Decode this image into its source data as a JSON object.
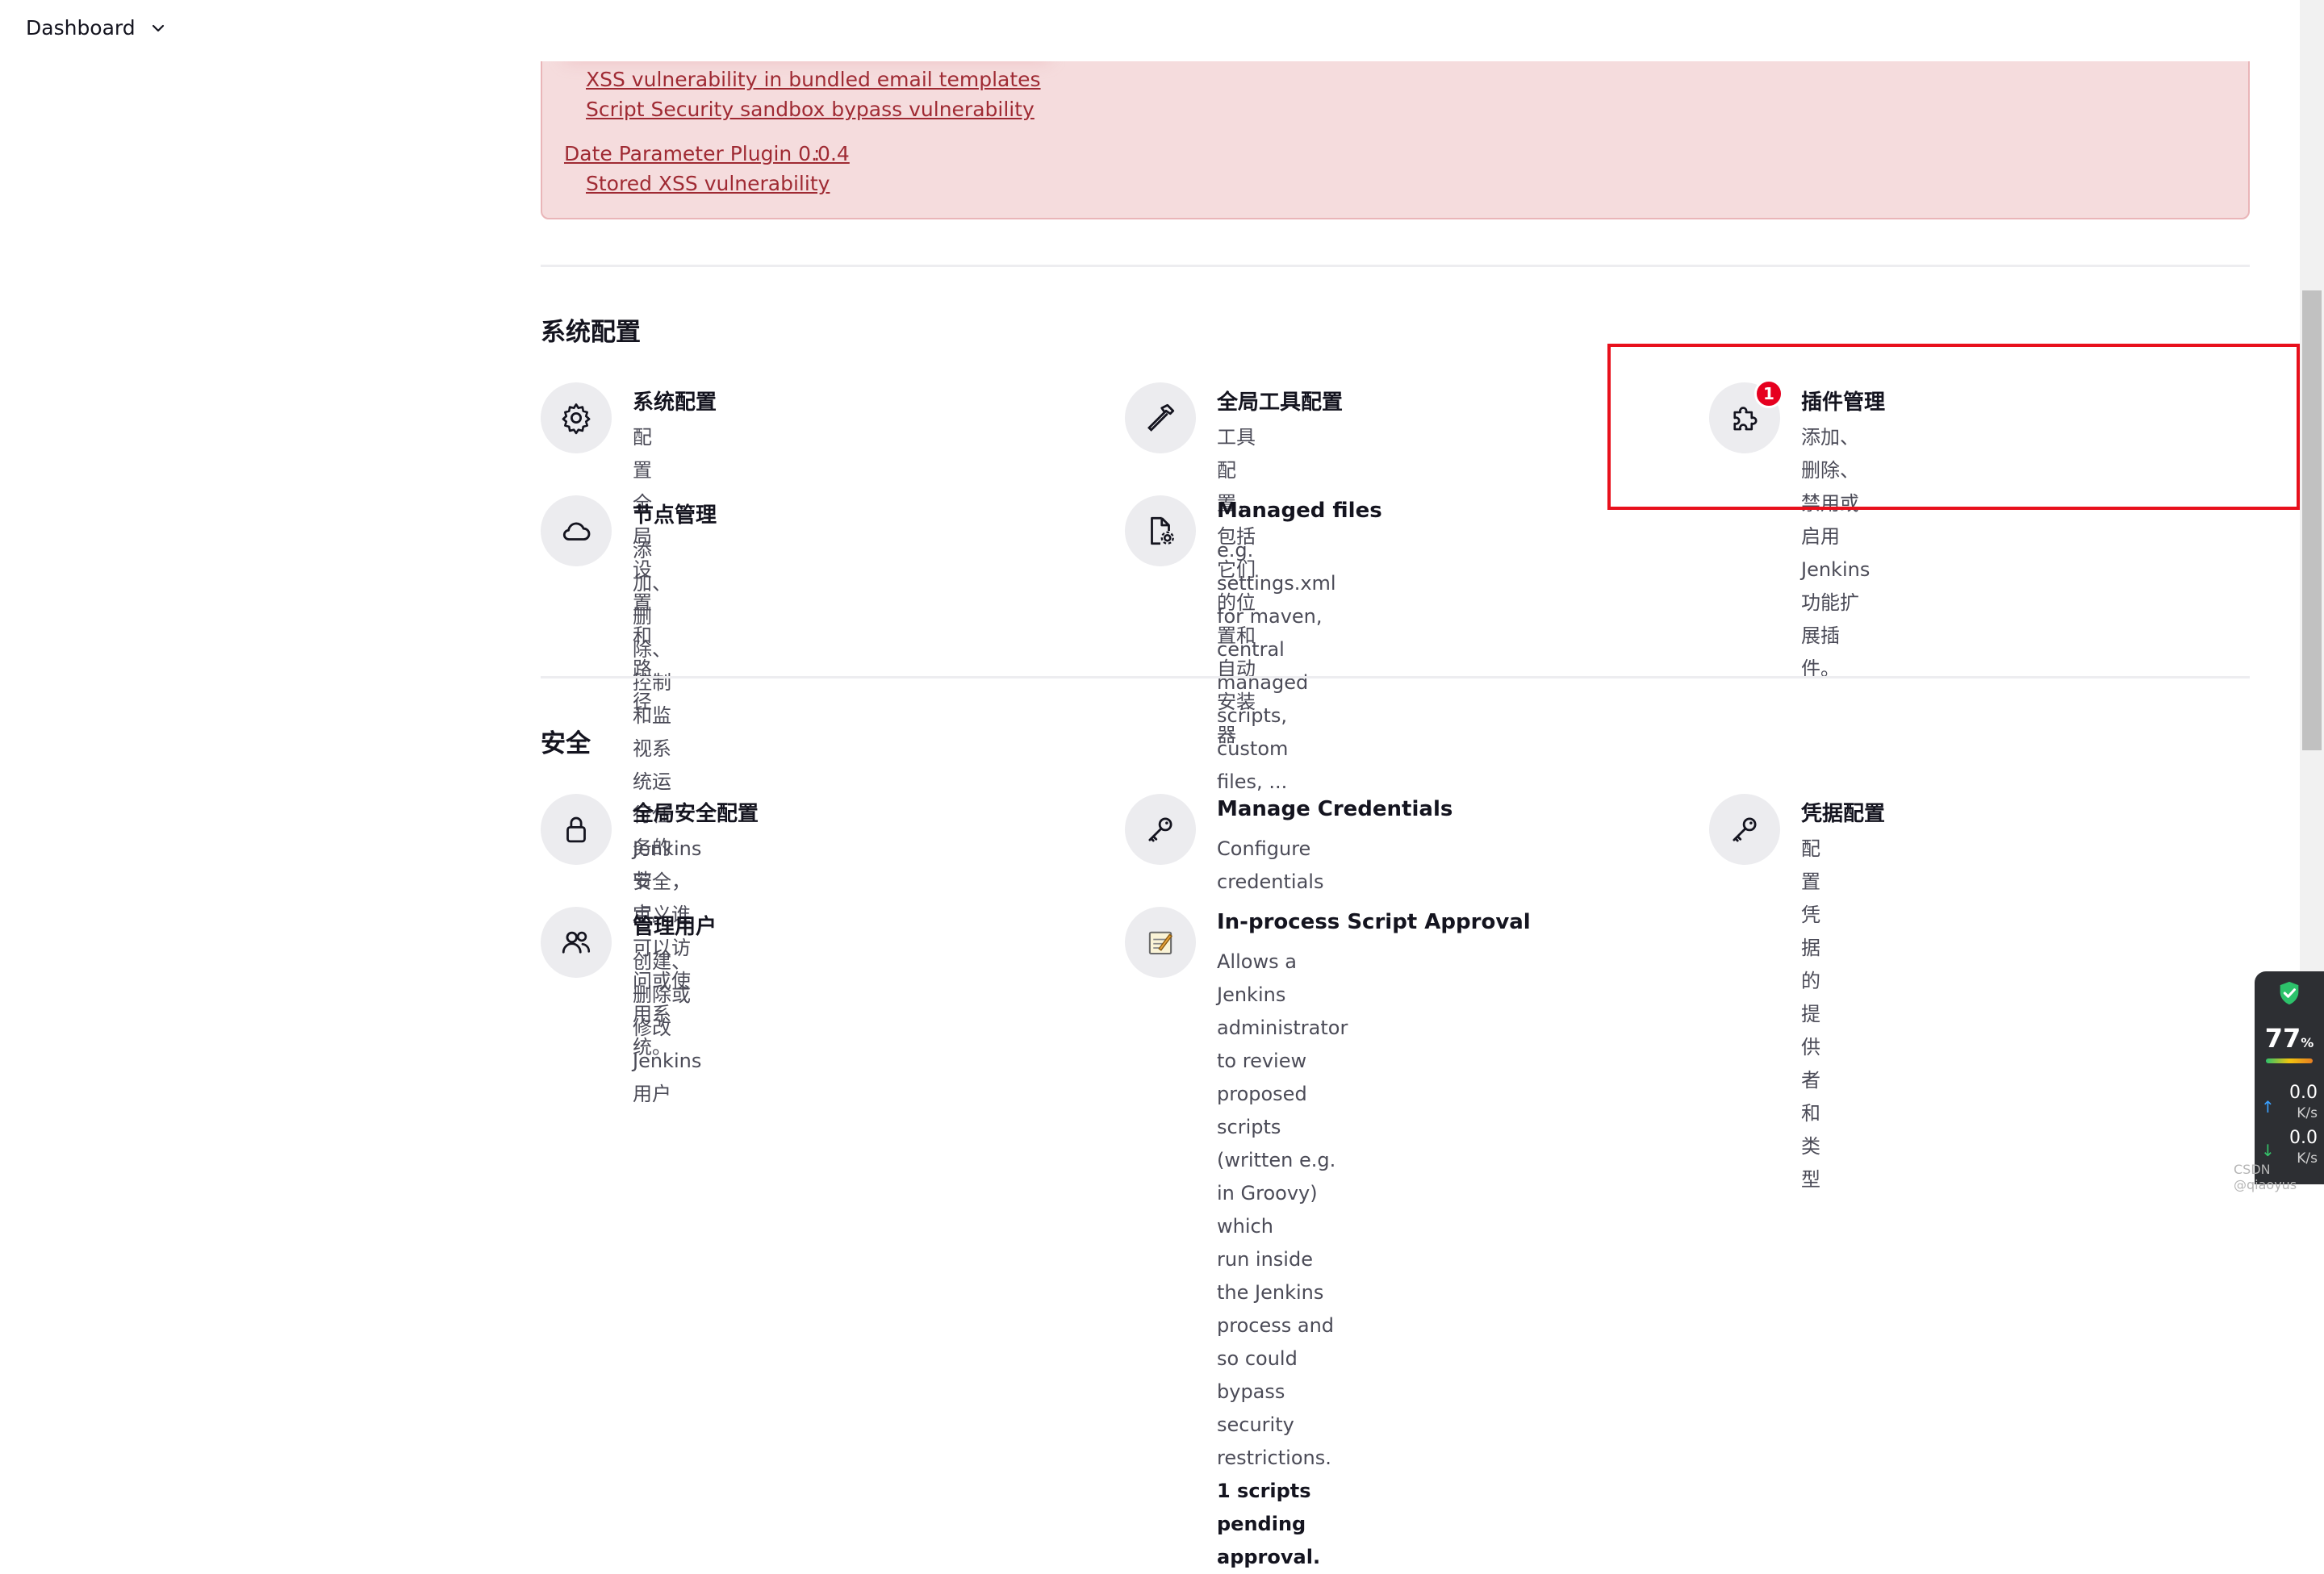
{
  "header": {
    "breadcrumb_label": "Dashboard"
  },
  "alert": {
    "links": [
      "XSS vulnerability in bundled email templates",
      "Script Security sandbox bypass vulnerability"
    ],
    "plugin_name": "Date Parameter Plugin 0.0.4",
    "plugin_colon": ":",
    "plugin_issue": "Stored XSS vulnerability"
  },
  "system_section": {
    "title": "系统配置",
    "items": [
      {
        "title": "系统配置",
        "desc": "配置全局设置和路径",
        "icon": "gear-icon"
      },
      {
        "title": "全局工具配置",
        "desc": "工具配置，包括它们的位置和自动安装器",
        "icon": "hammer-icon"
      },
      {
        "title": "插件管理",
        "desc": "添加、删除、禁用或启用Jenkins功能扩展插件。",
        "icon": "puzzle-icon",
        "badge": "1"
      },
      {
        "title": "节点管理",
        "desc": "添加、删除、控制和监视系统运行任务的节点。",
        "icon": "cloud-icon"
      },
      {
        "title": "Managed files",
        "desc_lines": [
          "e.g. settings.xml for maven, central managed",
          "scripts, custom files, ..."
        ],
        "icon": "file-gear-icon"
      }
    ]
  },
  "security_section": {
    "title": "安全",
    "items": [
      {
        "title": "全局安全配置",
        "desc": "Jenkins 安全，定义谁可以访问或使用系统。",
        "icon": "lock-icon"
      },
      {
        "title": "Manage Credentials",
        "desc": "Configure credentials",
        "icon": "key-icon"
      },
      {
        "title": "凭据配置",
        "desc": "配置凭据的提供者和类型",
        "icon": "key-icon"
      },
      {
        "title": "管理用户",
        "desc": "创建、删除或修改 Jenkins 用户",
        "icon": "users-icon"
      },
      {
        "title": "In-process Script Approval",
        "desc_lines": [
          "Allows a Jenkins administrator to review",
          "proposed scripts (written e.g. in Groovy) which",
          "run inside the Jenkins process and so could",
          "bypass security restrictions."
        ],
        "desc_bold_1": "1 scripts pending",
        "desc_bold_2": "approval.",
        "icon": "notepad-icon"
      }
    ]
  },
  "widget": {
    "percent": "77",
    "percent_unit": "%",
    "up_speed": "0.0",
    "up_unit": "K/s",
    "down_speed": "0.0",
    "down_unit": "K/s"
  },
  "watermark": "CSDN @qiaoyus",
  "colors": {
    "alert_bg": "#f5dcdd",
    "alert_link": "#9f2a33",
    "highlight_border": "#e8101c",
    "badge": "#e6001f"
  }
}
